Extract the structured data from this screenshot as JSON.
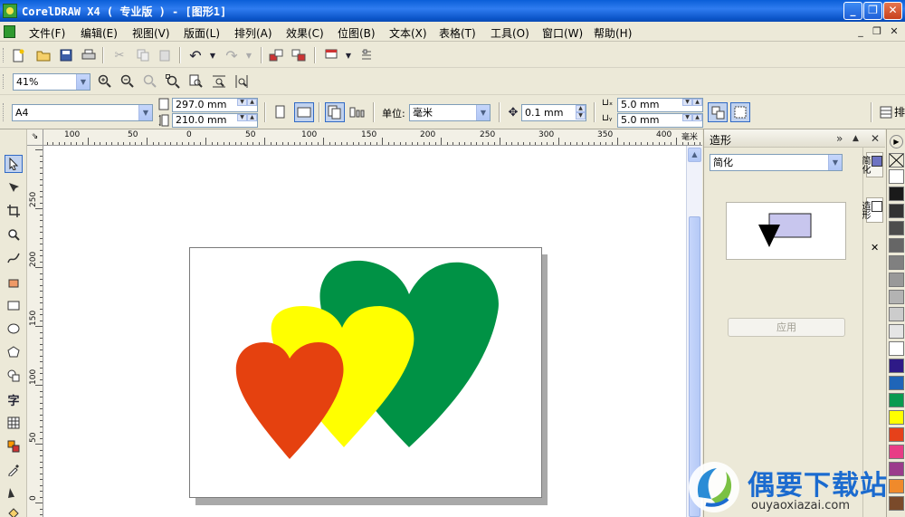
{
  "window": {
    "title": "CorelDRAW X4 ( 专业版 ) - [图形1]",
    "min_glyph": "_",
    "max_glyph": "❐",
    "close_glyph": "✕"
  },
  "menu": {
    "items": [
      "文件(F)",
      "编辑(E)",
      "视图(V)",
      "版面(L)",
      "排列(A)",
      "效果(C)",
      "位图(B)",
      "文本(X)",
      "表格(T)",
      "工具(O)",
      "窗口(W)",
      "帮助(H)"
    ],
    "mdi_min": "_",
    "mdi_restore": "❐",
    "mdi_close": "✕"
  },
  "toolbar2": {
    "zoom": "41%"
  },
  "property_bar": {
    "paper": "A4",
    "width": "297.0 mm",
    "height": "210.0 mm",
    "units_label": "单位:",
    "units": "毫米",
    "nudge": "0.1 mm",
    "dup_x": "5.0 mm",
    "dup_y": "5.0 mm",
    "overflow_text": "排"
  },
  "rulers": {
    "corner": "⇘",
    "h_labels": [
      "100",
      "50",
      "0",
      "50",
      "100",
      "150",
      "200",
      "250",
      "300",
      "350",
      "400",
      "毫米"
    ],
    "v_labels": [
      "250",
      "200",
      "150",
      "100",
      "50",
      "0"
    ]
  },
  "toolbox": {
    "text_tool": "字"
  },
  "docker": {
    "title": "造形",
    "mode": "简化",
    "apply": "应用",
    "expand_glyph": "»",
    "collapse_glyph": "▲",
    "close_glyph": "✕"
  },
  "docker_tabs": {
    "tab1": "简化",
    "tab2": "造形",
    "close": "✕"
  },
  "palette": {
    "colors": [
      "#ffffff",
      "#1a1a1a",
      "#333333",
      "#4d4d4d",
      "#666666",
      "#808080",
      "#999999",
      "#b3b3b3",
      "#cccccc",
      "#e5e5e5",
      "#ffffff",
      "#2e1a87",
      "#1f65b8",
      "#0a9a4f",
      "#ffff00",
      "#e6411a",
      "#e83c86",
      "#9b3b8c",
      "#f08a2b",
      "#7a4a2a"
    ]
  },
  "hearts": {
    "green": "#009245",
    "yellow": "#ffff00",
    "red": "#e5410f"
  },
  "watermark": {
    "brand": "偶要下载站",
    "url": "ouyaoxiazai.com"
  }
}
